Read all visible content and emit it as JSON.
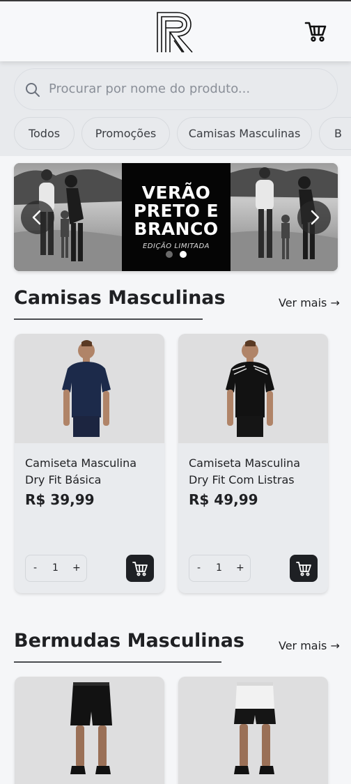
{
  "header": {
    "logo_text": "R",
    "cart_icon": "cart-icon"
  },
  "search": {
    "placeholder": "Procurar por nome do produto..."
  },
  "categories": [
    "Todos",
    "Promoções",
    "Camisas Masculinas",
    "B"
  ],
  "banner": {
    "title_lines": [
      "VERÃO",
      "PRETO E",
      "BRANCO"
    ],
    "subtitle": "EDIÇÃO LIMITADA"
  },
  "sections": [
    {
      "title": "Camisas Masculinas",
      "see_more": "Ver mais →",
      "products": [
        {
          "name": "Camiseta Masculina Dry Fit Básica",
          "price": "R$ 39,99",
          "qty": "1"
        },
        {
          "name": "Camiseta Masculina Dry Fit Com Listras",
          "price": "R$ 49,99",
          "qty": "1"
        }
      ]
    },
    {
      "title": "Bermudas Masculinas",
      "see_more": "Ver mais →"
    }
  ],
  "qty_labels": {
    "minus": "-",
    "plus": "+"
  },
  "colors": {
    "dark": "#1e2024",
    "background": "#f5f6f8",
    "card": "#e9ebee"
  }
}
